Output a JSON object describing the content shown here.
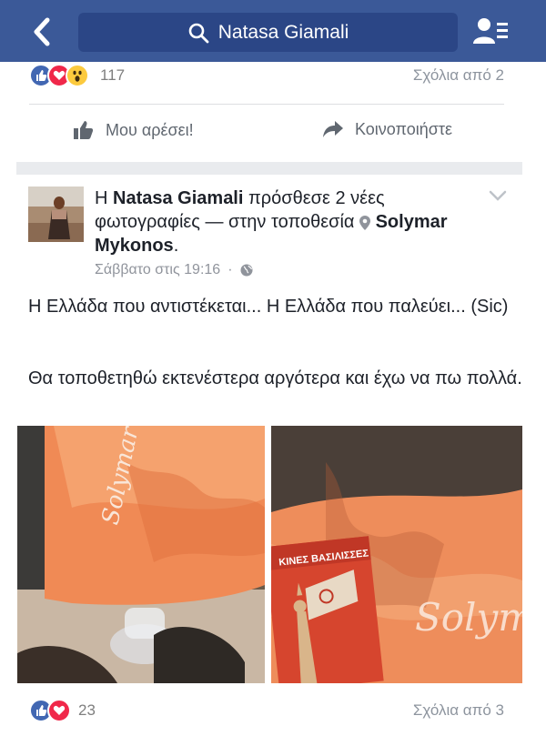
{
  "nav": {
    "search_text": "Natasa Giamali",
    "back_icon": "back-arrow-icon",
    "search_icon": "search-icon",
    "friends_icon": "friend-requests-icon",
    "color": "#3b5998"
  },
  "prev_post": {
    "reactions_count": "117",
    "reaction_icons": [
      "like-icon",
      "love-icon",
      "wow-icon"
    ],
    "comments_label": "Σχόλια από 2",
    "like_label": "Μου αρέσει!",
    "share_label": "Κοινοποιήστε"
  },
  "post": {
    "author": "Natasa Giamali",
    "prefix": "Η",
    "action": "πρόσθεσε 2 νέες φωτογραφίες — στην τοποθεσία",
    "location": "Solymar Mykonos",
    "timestamp": "Σάββατο στις 19:16",
    "separator": "·",
    "privacy_icon": "globe-icon",
    "text_line1": "Η Ελλάδα που αντιστέκεται... Η Ελλάδα που παλεύει... (Sic)",
    "text_line2": "Θα τοποθετηθώ εκτενέστερα αργότερα και έχω να πω πολλά.",
    "photo1_caption": "Solymar",
    "photo2_caption": "Solymar",
    "book_title_line1": "ΚΙΝΕΣ ΒΑΣΙΛΙΣΣΕΣ",
    "reactions_count": "23",
    "reaction_icons": [
      "like-icon",
      "love-icon"
    ],
    "comments_label": "Σχόλια από 3"
  }
}
